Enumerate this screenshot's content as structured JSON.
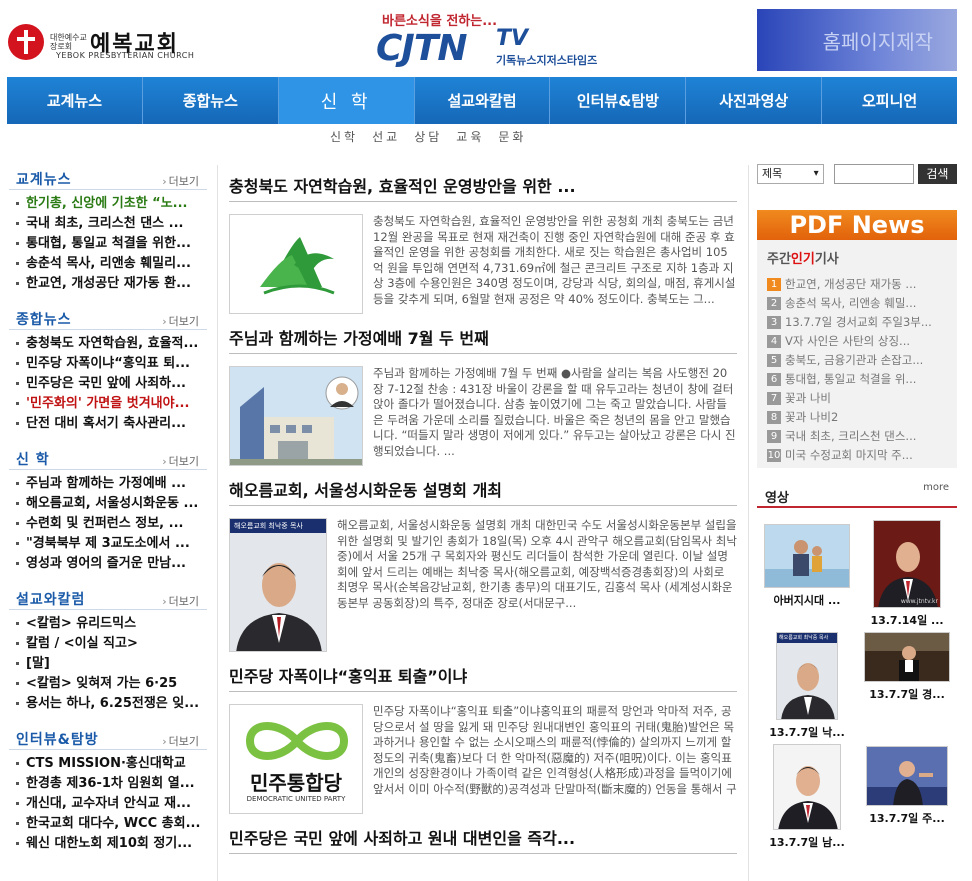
{
  "header": {
    "church_small": "대한예수교 장로회",
    "church_name": "예복교회",
    "church_eng": "YEBOK PRESBYTERIAN CHURCH",
    "tv_slogan": "바른소식을 전하는...",
    "tv_logo": "CJTN",
    "tv_suffix": "TV",
    "tv_sub": "기독뉴스지저스타임즈",
    "banner": "홈페이지제작"
  },
  "nav": {
    "items": [
      "교계뉴스",
      "종합뉴스",
      "신 학",
      "설교와칼럼",
      "인터뷰&탐방",
      "사진과영상",
      "오피니언"
    ],
    "sub": [
      "신학",
      "선교",
      "상담",
      "교육",
      "문화"
    ]
  },
  "left": {
    "more": "더보기",
    "sections": [
      {
        "title": "교계뉴스",
        "items": [
          "한기총, 신앙에 기초한 “노...",
          "국내 최초, 크리스천 댄스 ...",
          "통대협, 통일교 척결을 위한...",
          "송춘석 목사, 리앤송 훼밀리...",
          "한교연, 개성공단 재가동 환..."
        ]
      },
      {
        "title": "종합뉴스",
        "items": [
          "충청북도 자연학습원, 효율적...",
          "민주당 자폭이냐“홍익표 퇴...",
          "민주당은 국민 앞에 사죄하...",
          "'민주화의' 가면을 벗겨내야...",
          "단전 대비 혹서기 축사관리..."
        ]
      },
      {
        "title": "신 학",
        "items": [
          "주님과 함께하는 가정예배 ...",
          "해오름교회, 서울성시화운동 ...",
          "수련회 및 컨퍼런스 정보, ...",
          "\"경북북부 제 3교도소에서 ...",
          "영성과 영어의 즐거운 만남..."
        ]
      },
      {
        "title": "설교와칼럼",
        "items": [
          "<칼럼> 유리드믹스",
          "칼럼 / <이실 직고>",
          "[말]",
          "<칼럼> 잊혀져 가는 6·25",
          "용서는 하나, 6.25전쟁은 잊..."
        ]
      },
      {
        "title": "인터뷰&탐방",
        "items": [
          "CTS MISSION·홍신대학교",
          "한경총 제36-1차 임원회 열...",
          "개신대, 교수자녀 안식교 재...",
          "한국교회 대다수, WCC 총회...",
          "웨신 대한노회 제10회 정기..."
        ]
      }
    ]
  },
  "articles": [
    {
      "title": "충청북도 자연학습원, 효율적인 운영방안을 위한 ...",
      "text": "충청북도 자연학습원, 효율적인 운영방안을 위한 공청회 개최 충북도는 금년 12월 완공을 목표로 현재 재건축이 진행 중인 자연학습원에 대해 준공 후 효율적인 운영을 위한 공청회를 개최한다. 새로 짓는 학습원은 총사업비 105억 원을 투입해 연면적 4,731.69㎡에 철근 콘크리트 구조로 지하 1층과 지상 3층에 수용인원은 340명 정도이며, 강당과 식당, 회의실, 매점, 휴게시설 등을 갖추게 되며, 6월말 현재 공정은 약 40% 정도이다. 충북도는 그..."
    },
    {
      "title": "주님과 함께하는 가정예배 7월 두 번째",
      "text": "주님과 함께하는 가정예배 7월 두 번째 ●사람을 살리는 복음 사도행전 20장 7-12절 찬송 : 431장 바울이 강론을 할 때 유두고라는 청년이 창에 걸터앉아 졸다가 떨어졌습니다. 삼층 높이였기에 그는 죽고 말았습니다. 사람들은 두려움 가운데 소리를 질렀습니다. 바울은 죽은 청년의 몸을 안고 말했습니다. “떠들지 말라 생명이 저에게 있다.” 유두고는 살아났고 강론은 다시 진행되었습니다. ..."
    },
    {
      "title": "해오름교회, 서울성시화운동 설명회 개최",
      "text": "해오름교회, 서울성시화운동 설명회 개최 대한민국 수도 서울성시화운동본부 설립을 위한 설명회 및 발기인 총회가 18일(목) 오후 4시 관악구 해오름교회(담임목사 최낙중)에서 서울 25개 구 목회자와 평신도 리더들이 참석한 가운데 열린다. 이날 설명회에 앞서 드리는 예배는 최낙중 목사(해오름교회, 예장백석증경총회장)의 사회로 최명우 목사(순복음강남교회, 한기총 총무)의 대표기도, 김홍석 목사 (세계성시화운동본부 공동회장)의 특주, 정대준 장로(서대문구...",
      "badge": "해오름교회 최낙중 목사"
    },
    {
      "title": "민주당 자폭이냐“홍익표 퇴출”이냐",
      "text": "민주당 자폭이냐“홍익표 퇴출”이냐홍익표의 패륜적 망언과 악마적 저주, 공당으로서 설 땅을 잃게 돼 민주당 원내대변인 홍익표의 귀태(鬼胎)발언은 목과하거나 용인할 수 없는 소시오패스의 패륜적(悖倫的) 살의까지 느끼게 할 정도의 귀축(鬼畜)보다 더 한 악마적(惡魔的) 저주(咀呪)이다. 이는 홍익표 개인의 성장환경이나 가족이력 같은 인격형성(人格形成)과정을 들먹이기에 앞서서 이미 아수적(野獸的)공격성과 단말마적(斷末魔的) 언동을 통해서 구제불능의 인격파탄...",
      "logo_text": "민주통합당",
      "logo_sub": "DEMOCRATIC UNITED PARTY"
    },
    {
      "title": "민주당은 국민 앞에 사죄하고 원내 대변인을 즉각..."
    }
  ],
  "right": {
    "search_select": "제목",
    "search_btn": "검색",
    "pdf_title": "PDF News",
    "popular_prefix": "주간",
    "popular_hot": "인기",
    "popular_suffix": "기사",
    "popular": [
      {
        "n": "1",
        "t": "한교연, 개성공단 재가동 ..."
      },
      {
        "n": "2",
        "t": "송춘석 목사, 리앤송 훼밀..."
      },
      {
        "n": "3",
        "t": "13.7.7일 경서교회 주일3부..."
      },
      {
        "n": "4",
        "t": "V자 사인은 사탄의 상징..."
      },
      {
        "n": "5",
        "t": "충북도, 금융기관과 손잡고..."
      },
      {
        "n": "6",
        "t": "통대협, 통일교 척결을 위..."
      },
      {
        "n": "7",
        "t": "꽃과 나비"
      },
      {
        "n": "8",
        "t": "꽃과 나비2"
      },
      {
        "n": "9",
        "t": "국내 최초, 크리스천 댄스..."
      },
      {
        "n": "10",
        "t": "미국 수정교회 마지막 주..."
      }
    ],
    "video_title": "영상",
    "video_more": "more",
    "videos": [
      "아버지시대 ...",
      "13.7.14일 ...",
      "13.7.7일 낙...",
      "13.7.7일 경...",
      "13.7.7일 남...",
      "13.7.7일 주..."
    ],
    "video_badge": "해오름교회 최낙중 목사",
    "watermark": "www.jtntv.kr"
  },
  "colors": {
    "nav": "#1667b7",
    "accent": "#c0262f",
    "pdf": "#f08a1e",
    "section_title": "#1a5aa8"
  }
}
